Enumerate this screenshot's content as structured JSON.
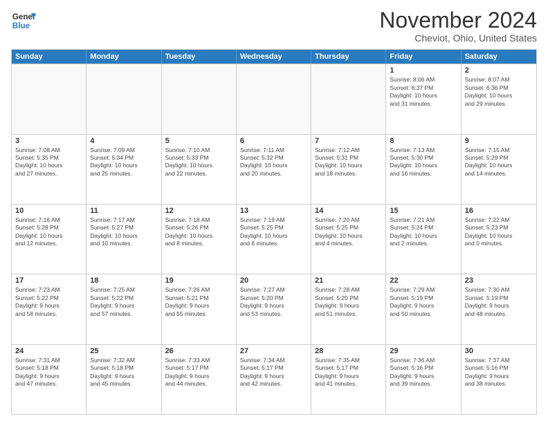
{
  "logo": {
    "general": "General",
    "blue": "Blue"
  },
  "title": "November 2024",
  "location": "Cheviot, Ohio, United States",
  "headers": [
    "Sunday",
    "Monday",
    "Tuesday",
    "Wednesday",
    "Thursday",
    "Friday",
    "Saturday"
  ],
  "rows": [
    [
      {
        "day": "",
        "info": ""
      },
      {
        "day": "",
        "info": ""
      },
      {
        "day": "",
        "info": ""
      },
      {
        "day": "",
        "info": ""
      },
      {
        "day": "",
        "info": ""
      },
      {
        "day": "1",
        "info": "Sunrise: 8:06 AM\nSunset: 6:37 PM\nDaylight: 10 hours\nand 31 minutes."
      },
      {
        "day": "2",
        "info": "Sunrise: 8:07 AM\nSunset: 6:36 PM\nDaylight: 10 hours\nand 29 minutes."
      }
    ],
    [
      {
        "day": "3",
        "info": "Sunrise: 7:08 AM\nSunset: 5:35 PM\nDaylight: 10 hours\nand 27 minutes."
      },
      {
        "day": "4",
        "info": "Sunrise: 7:09 AM\nSunset: 5:34 PM\nDaylight: 10 hours\nand 25 minutes."
      },
      {
        "day": "5",
        "info": "Sunrise: 7:10 AM\nSunset: 5:33 PM\nDaylight: 10 hours\nand 22 minutes."
      },
      {
        "day": "6",
        "info": "Sunrise: 7:11 AM\nSunset: 5:32 PM\nDaylight: 10 hours\nand 20 minutes."
      },
      {
        "day": "7",
        "info": "Sunrise: 7:12 AM\nSunset: 5:31 PM\nDaylight: 10 hours\nand 18 minutes."
      },
      {
        "day": "8",
        "info": "Sunrise: 7:13 AM\nSunset: 5:30 PM\nDaylight: 10 hours\nand 16 minutes."
      },
      {
        "day": "9",
        "info": "Sunrise: 7:15 AM\nSunset: 5:29 PM\nDaylight: 10 hours\nand 14 minutes."
      }
    ],
    [
      {
        "day": "10",
        "info": "Sunrise: 7:16 AM\nSunset: 5:28 PM\nDaylight: 10 hours\nand 12 minutes."
      },
      {
        "day": "11",
        "info": "Sunrise: 7:17 AM\nSunset: 5:27 PM\nDaylight: 10 hours\nand 10 minutes."
      },
      {
        "day": "12",
        "info": "Sunrise: 7:18 AM\nSunset: 5:26 PM\nDaylight: 10 hours\nand 8 minutes."
      },
      {
        "day": "13",
        "info": "Sunrise: 7:19 AM\nSunset: 5:25 PM\nDaylight: 10 hours\nand 6 minutes."
      },
      {
        "day": "14",
        "info": "Sunrise: 7:20 AM\nSunset: 5:25 PM\nDaylight: 10 hours\nand 4 minutes."
      },
      {
        "day": "15",
        "info": "Sunrise: 7:21 AM\nSunset: 5:24 PM\nDaylight: 10 hours\nand 2 minutes."
      },
      {
        "day": "16",
        "info": "Sunrise: 7:22 AM\nSunset: 5:23 PM\nDaylight: 10 hours\nand 0 minutes."
      }
    ],
    [
      {
        "day": "17",
        "info": "Sunrise: 7:23 AM\nSunset: 5:22 PM\nDaylight: 9 hours\nand 58 minutes."
      },
      {
        "day": "18",
        "info": "Sunrise: 7:25 AM\nSunset: 5:22 PM\nDaylight: 9 hours\nand 57 minutes."
      },
      {
        "day": "19",
        "info": "Sunrise: 7:26 AM\nSunset: 5:21 PM\nDaylight: 9 hours\nand 55 minutes."
      },
      {
        "day": "20",
        "info": "Sunrise: 7:27 AM\nSunset: 5:20 PM\nDaylight: 9 hours\nand 53 minutes."
      },
      {
        "day": "21",
        "info": "Sunrise: 7:28 AM\nSunset: 5:20 PM\nDaylight: 9 hours\nand 51 minutes."
      },
      {
        "day": "22",
        "info": "Sunrise: 7:29 AM\nSunset: 5:19 PM\nDaylight: 9 hours\nand 50 minutes."
      },
      {
        "day": "23",
        "info": "Sunrise: 7:30 AM\nSunset: 5:19 PM\nDaylight: 9 hours\nand 48 minutes."
      }
    ],
    [
      {
        "day": "24",
        "info": "Sunrise: 7:31 AM\nSunset: 5:18 PM\nDaylight: 9 hours\nand 47 minutes."
      },
      {
        "day": "25",
        "info": "Sunrise: 7:32 AM\nSunset: 5:18 PM\nDaylight: 9 hours\nand 45 minutes."
      },
      {
        "day": "26",
        "info": "Sunrise: 7:33 AM\nSunset: 5:17 PM\nDaylight: 9 hours\nand 44 minutes."
      },
      {
        "day": "27",
        "info": "Sunrise: 7:34 AM\nSunset: 5:17 PM\nDaylight: 9 hours\nand 42 minutes."
      },
      {
        "day": "28",
        "info": "Sunrise: 7:35 AM\nSunset: 5:17 PM\nDaylight: 9 hours\nand 41 minutes."
      },
      {
        "day": "29",
        "info": "Sunrise: 7:36 AM\nSunset: 5:16 PM\nDaylight: 9 hours\nand 39 minutes."
      },
      {
        "day": "30",
        "info": "Sunrise: 7:37 AM\nSunset: 5:16 PM\nDaylight: 9 hours\nand 38 minutes."
      }
    ]
  ]
}
